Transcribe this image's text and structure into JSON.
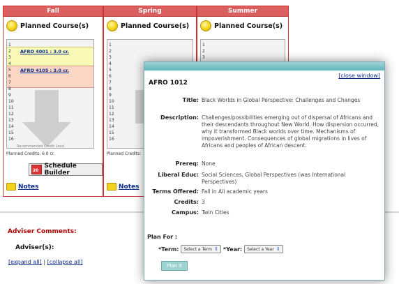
{
  "terms": [
    {
      "name": "Fall",
      "planned_label": "Planned Course(s)",
      "courses": [
        "AFRO 4001 : 3.0 cr.",
        "AFRO 4105 : 3.0 cr."
      ],
      "recommended_label": "Recommended Credit Load",
      "credits": "Planned Credits: 6.0 cr.",
      "notes": "Notes"
    },
    {
      "name": "Spring",
      "planned_label": "Planned Course(s)",
      "credits": "Planned Credits:",
      "notes": "Notes"
    },
    {
      "name": "Summer",
      "planned_label": "Planned Course(s)"
    }
  ],
  "schedule_builder": "Schedule Builder",
  "adviser": {
    "comments_title": "Adviser Comments:",
    "advisers_label": "Adviser(s):",
    "expand_all": "[expand all]",
    "separator": "|",
    "collapse_all": "[collapse all]"
  },
  "popup": {
    "close": "[close window]",
    "course_code": "AFRO 1012",
    "fields": [
      {
        "label": "Title:",
        "value": "Black Worlds in Global Perspective: Challenges and Changes"
      },
      {
        "label": "Description:",
        "value": "Challenges/possibilities emerging out of dispersal of Africans and their descendants throughout New World. How dispersion occurred, why it transformed Black worlds over time. Mechanisms of impoverishment. Consequences of global migrations in lives of Africans and peoples of African descent."
      },
      {
        "label": "Prereq:",
        "value": "None"
      },
      {
        "label": "Liberal Educ:",
        "value": "Social Sciences, Global Perspectives (was International Perspectives)"
      },
      {
        "label": "Terms Offered:",
        "value": "Fall in All academic years"
      },
      {
        "label": "Credits:",
        "value": "3"
      },
      {
        "label": "Campus:",
        "value": "Twin Cities"
      }
    ],
    "plan_for": "Plan For :",
    "term_label": "*Term:",
    "term_select": "Select a Term",
    "year_label": "*Year:",
    "year_select": "Select a Year",
    "plan_button": "Plan it"
  }
}
